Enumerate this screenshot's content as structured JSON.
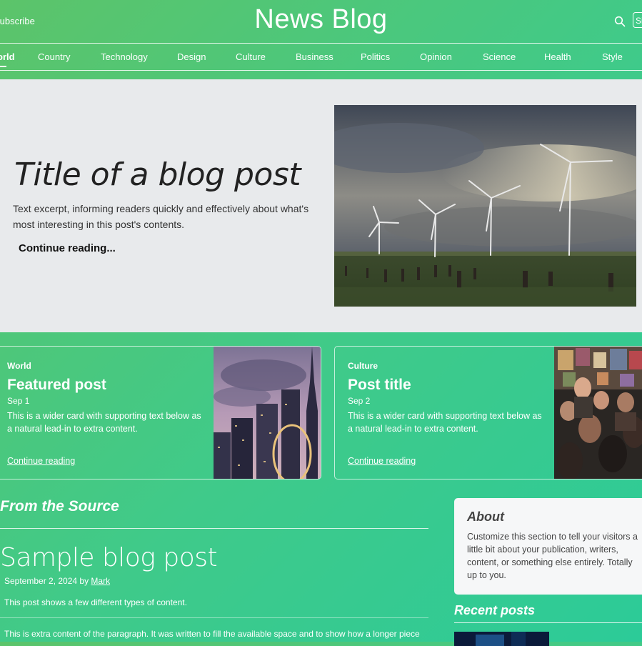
{
  "header": {
    "subscribe_label": "Subscribe",
    "brand": "News Blog",
    "signup_label": "Sign up"
  },
  "nav": {
    "items": [
      "World",
      "Country",
      "Technology",
      "Design",
      "Culture",
      "Business",
      "Politics",
      "Opinion",
      "Science",
      "Health",
      "Style"
    ],
    "active": "World"
  },
  "hero": {
    "title": "Title of a blog post",
    "excerpt": "Text excerpt, informing readers quickly and effectively about what's most interesting in this post's contents.",
    "link": "Continue reading..."
  },
  "cards": [
    {
      "category": "World",
      "title": "Featured post",
      "date": "Sep 1",
      "text": "This is a wider card with supporting text below as a natural lead-in to extra content.",
      "link": "Continue reading"
    },
    {
      "category": "Culture",
      "title": "Post title",
      "date": "Sep 2",
      "text": "This is a wider card with supporting text below as a natural lead-in to extra content.",
      "link": "Continue reading"
    }
  ],
  "main": {
    "section_heading": "From the Source",
    "post_title": "Sample blog post",
    "post_date": "September 2, 2024 by",
    "post_author": "Mark",
    "post_lead": "This post shows a few different types of content.",
    "post_body": "This is extra content of the paragraph. It was written to fill the available space and to show how a longer piece"
  },
  "sidebar": {
    "about_title": "About",
    "about_text": "Customize this section to tell your visitors a little bit about your publication, writers, content, or something else entirely. Totally up to you.",
    "recent_heading": "Recent posts"
  },
  "colors": {
    "gradient_start": "#5cc46a",
    "gradient_end": "#2ccb98",
    "hero_bg": "#e8eaec"
  }
}
